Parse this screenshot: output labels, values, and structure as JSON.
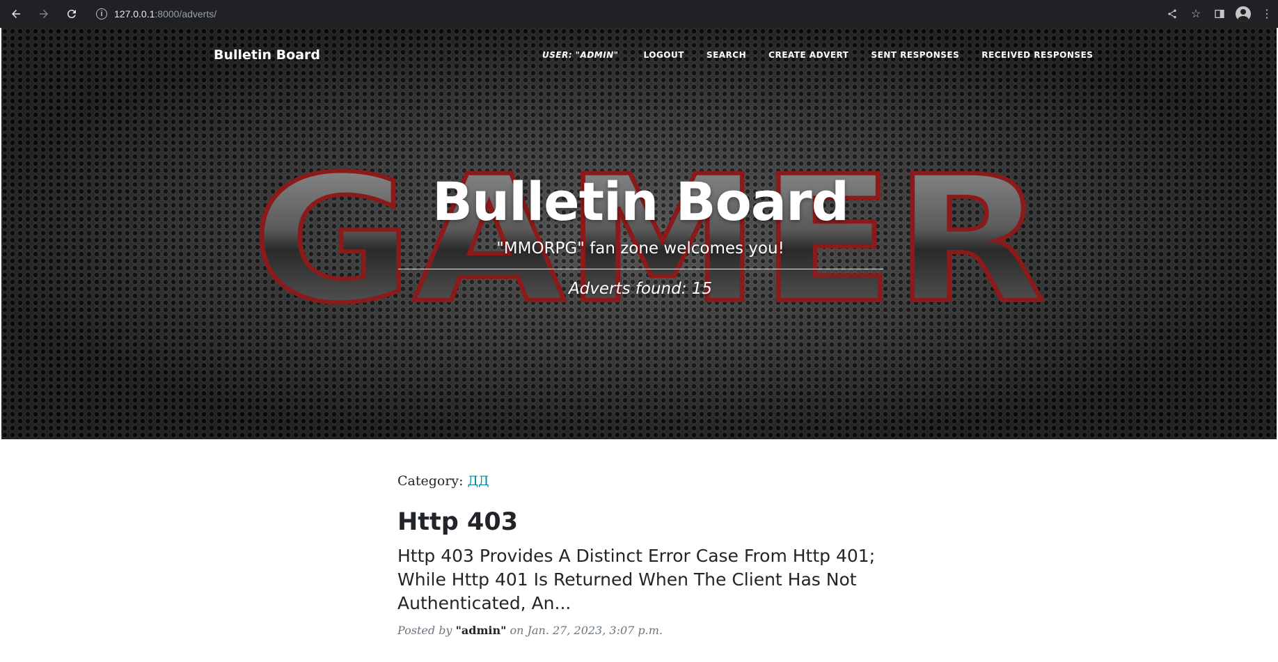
{
  "browser": {
    "url_host": "127.0.0.1",
    "url_rest": ":8000/adverts/"
  },
  "site": {
    "brand": "Bulletin Board"
  },
  "nav": {
    "user": "User: \"admin\"",
    "logout": "Logout",
    "search": "Search",
    "create": "Create Advert",
    "sent": "Sent Responses",
    "received": "Received Responses"
  },
  "hero": {
    "background_text": "GAMER",
    "title": "Bulletin Board",
    "subtitle": "\"MMORPG\" fan zone welcomes you!",
    "count": "Adverts found: 15"
  },
  "post": {
    "category_label": "Category:",
    "category_value": "ДД",
    "title": "Http 403",
    "excerpt": "Http 403 Provides A Distinct Error Case From Http 401; While Http 401 Is Returned When The Client Has Not Authenticated, An...",
    "meta_prefix": "Posted by",
    "author": "\"admin\"",
    "meta_on": "on Jan. 27, 2023, 3:07 p.m."
  },
  "colors": {
    "link": "#0085a1",
    "chrome": "#202124"
  }
}
